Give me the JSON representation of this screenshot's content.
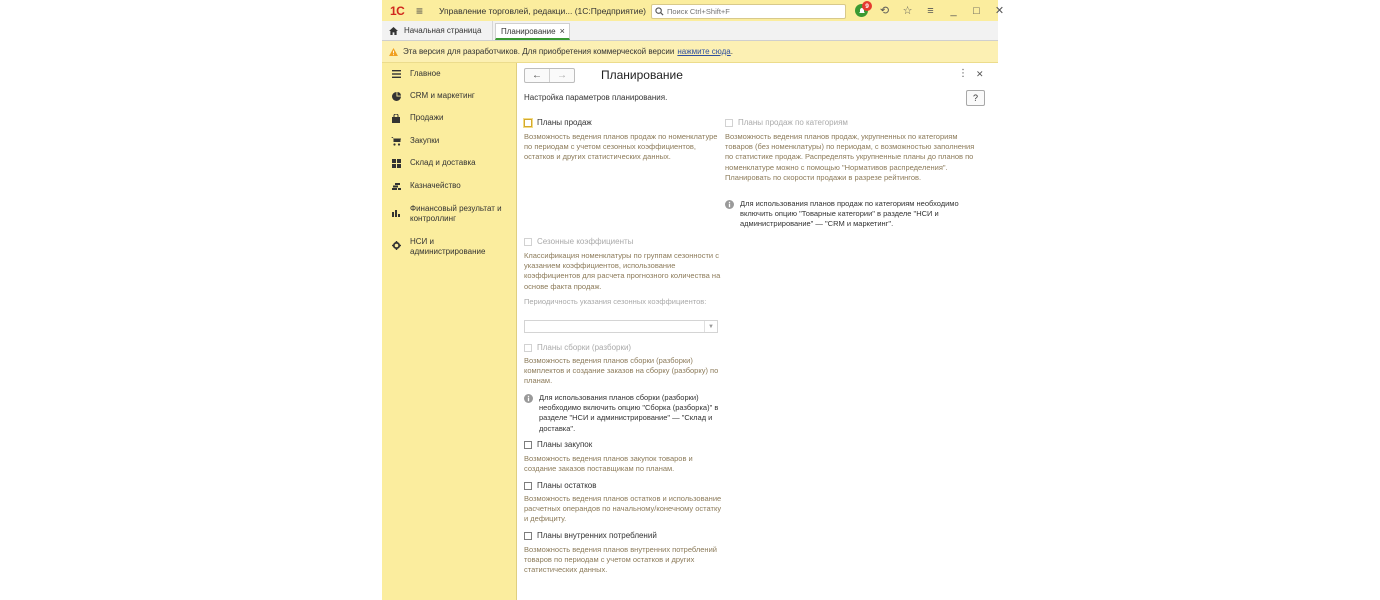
{
  "titlebar": {
    "logo": "1С",
    "title": "Управление торговлей, редакци... (1С:Предприятие)",
    "search_placeholder": "Поиск Ctrl+Shift+F",
    "notification_count": "9"
  },
  "tabs": {
    "home_label": "Начальная страница",
    "active_label": "Планирование"
  },
  "banner": {
    "text": "Эта версия для разработчиков. Для приобретения коммерческой версии",
    "link": "нажмите сюда",
    "suffix": "."
  },
  "sidebar": {
    "items": [
      {
        "label": "Главное",
        "icon": "menu-lines-icon"
      },
      {
        "label": "CRM и маркетинг",
        "icon": "pie-chart-icon"
      },
      {
        "label": "Продажи",
        "icon": "shopping-bag-icon"
      },
      {
        "label": "Закупки",
        "icon": "cart-icon"
      },
      {
        "label": "Склад и доставка",
        "icon": "grid-icon"
      },
      {
        "label": "Казначейство",
        "icon": "coins-icon"
      },
      {
        "label": "Финансовый результат и контроллинг",
        "icon": "bar-chart-icon"
      },
      {
        "label": "НСИ и администрирование",
        "icon": "gear-icon"
      }
    ]
  },
  "form": {
    "title": "Планирование",
    "subtitle": "Настройка параметров планирования.",
    "help": "?",
    "sales_plans": {
      "label": "Планы продаж",
      "desc": "Возможность ведения планов продаж по номенклатуре по периодам с учетом сезонных коэффициентов, остатков и других статистических данных."
    },
    "category_plans": {
      "label": "Планы продаж по категориям",
      "desc": "Возможность ведения планов продаж, укрупненных по категориям товаров (без номенклатуры) по периодам, с возможностью заполнения по статистике продаж. Распределять укрупненные планы до планов по номенклатуре можно с помощью \"Нормативов распределения\". Планировать по скорости продажи в разрезе рейтингов.",
      "info": "Для использования планов продаж по категориям необходимо включить опцию \"Товарные категории\" в разделе \"НСИ и администрирование\" — \"CRM и маркетинг\"."
    },
    "seasonal": {
      "label": "Сезонные коэффициенты",
      "desc": "Классификация номенклатуры по группам сезонности с указанием коэффициентов, использование коэффициентов для расчета прогнозного количества на основе факта продаж.",
      "period_label": "Периодичность указания сезонных коэффициентов:"
    },
    "assembly": {
      "label": "Планы сборки (разборки)",
      "desc": "Возможность ведения планов сборки (разборки) комплектов и создание заказов на сборку (разборку) по планам.",
      "info": "Для использования планов сборки (разборки) необходимо включить опцию \"Сборка (разборка)\" в разделе \"НСИ и администрирование\" — \"Склад и доставка\"."
    },
    "purchases": {
      "label": "Планы закупок",
      "desc": "Возможность ведения планов закупок товаров и создание заказов поставщикам по планам."
    },
    "stock": {
      "label": "Планы остатков",
      "desc": "Возможность ведения планов остатков и использование расчетных операндов по начальному/конечному остатку и дефициту."
    },
    "internal": {
      "label": "Планы внутренних потреблений",
      "desc": "Возможность ведения планов внутренних потреблений товаров по периодам с учетом остатков и других статистических данных."
    }
  },
  "colors": {
    "panel_yellow": "#fbed9e",
    "banner_yellow": "#fcf0b3",
    "accent_green": "#3a9a32",
    "hint_brown": "#8c7b5a",
    "brand_red": "#d0271d"
  }
}
